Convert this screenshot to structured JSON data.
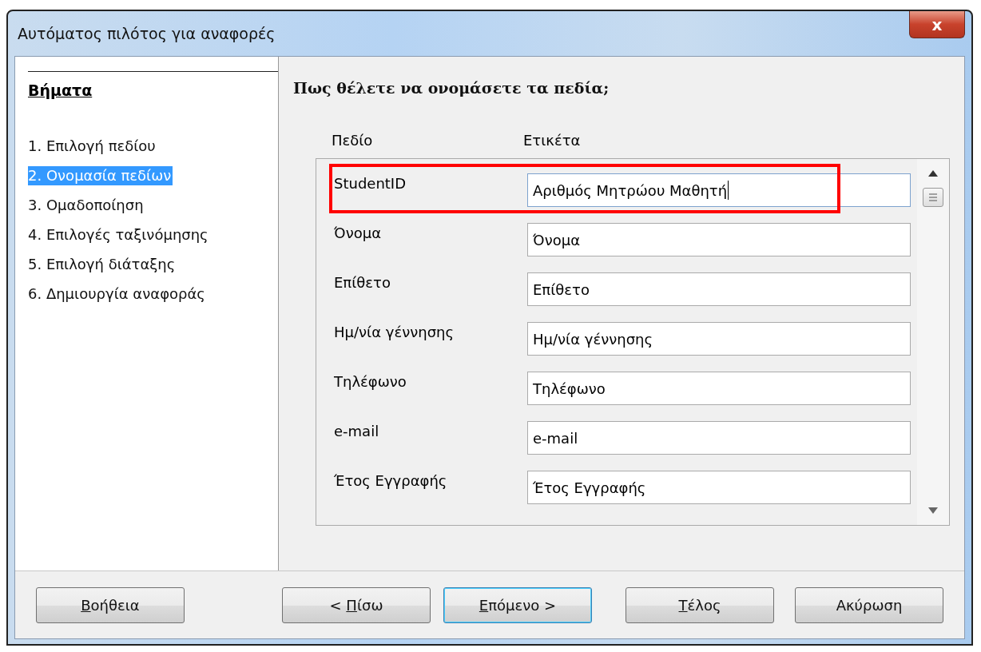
{
  "window": {
    "title": "Αυτόματος πιλότος για αναφορές",
    "close": "x"
  },
  "sidebar": {
    "heading": "Βήματα",
    "items": [
      {
        "label": "1. Επιλογή πεδίου",
        "selected": false
      },
      {
        "label": "2. Ονομασία πεδίων",
        "selected": true
      },
      {
        "label": "3. Ομαδοποίηση",
        "selected": false
      },
      {
        "label": "4. Επιλογές ταξινόμησης",
        "selected": false
      },
      {
        "label": "5. Επιλογή διάταξης",
        "selected": false
      },
      {
        "label": "6. Δημιουργία αναφοράς",
        "selected": false
      }
    ]
  },
  "content": {
    "heading": "Πως θέλετε να ονομάσετε τα πεδία;",
    "columns": [
      "Πεδίο",
      "Ετικέτα"
    ],
    "rows": [
      {
        "field": "StudentID",
        "value": "Αριθμός Μητρώου Μαθητή",
        "highlighted": true,
        "focused": true
      },
      {
        "field": "Όνομα",
        "value": "Όνομα",
        "highlighted": false,
        "focused": false
      },
      {
        "field": "Επίθετο",
        "value": "Επίθετο",
        "highlighted": false,
        "focused": false
      },
      {
        "field": "Ημ/νία γέννησης",
        "value": "Ημ/νία γέννησης",
        "highlighted": false,
        "focused": false
      },
      {
        "field": "Τηλέφωνο",
        "value": "Τηλέφωνο",
        "highlighted": false,
        "focused": false
      },
      {
        "field": "e-mail",
        "value": "e-mail",
        "highlighted": false,
        "focused": false
      },
      {
        "field": "Έτος Εγγραφής",
        "value": "Έτος Εγγραφής",
        "highlighted": false,
        "focused": false
      }
    ]
  },
  "buttons": [
    {
      "key": "Β",
      "after": "οήθεια",
      "default": false
    },
    {
      "before": "< ",
      "key": "Π",
      "after": "ίσω",
      "default": false
    },
    {
      "key": "Ε",
      "after": "πόμενο >",
      "default": true
    },
    {
      "key": "Τ",
      "after": "έλος",
      "default": false
    },
    {
      "after": "Ακύρωση",
      "default": false
    }
  ]
}
